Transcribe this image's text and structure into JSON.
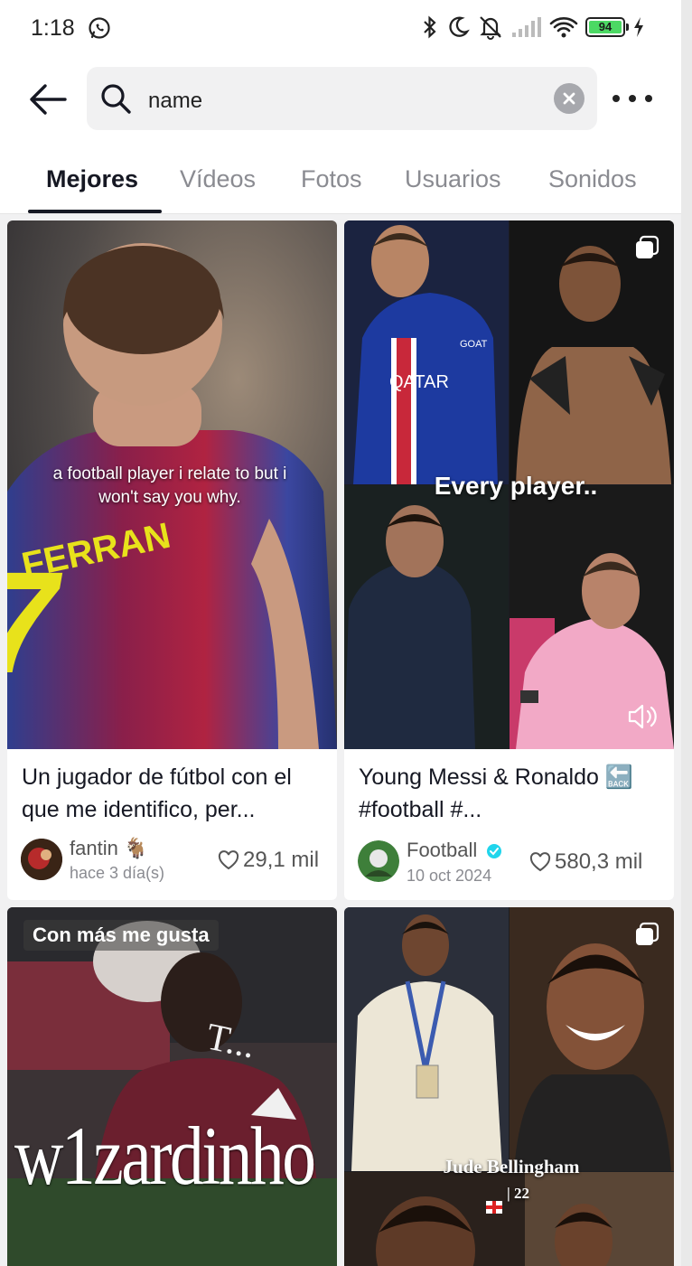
{
  "status_bar": {
    "time": "1:18",
    "battery": "94"
  },
  "search": {
    "query": "name"
  },
  "tabs": [
    {
      "label": "Mejores",
      "active": true
    },
    {
      "label": "Vídeos",
      "active": false
    },
    {
      "label": "Fotos",
      "active": false
    },
    {
      "label": "Usuarios",
      "active": false
    },
    {
      "label": "Sonidos",
      "active": false
    }
  ],
  "results": [
    {
      "overlay": "a football player i relate to but i won't say you why.",
      "jersey_name": "FERRAN",
      "jersey_number": "7",
      "caption": "Un jugador de fútbol con el que me identifico, per...",
      "author": "fantin 🐐",
      "date": "hace 3 día(s)",
      "likes": "29,1 mil"
    },
    {
      "overlay": "Every player..",
      "caption": "Young Messi & Ronaldo 🔙 #football #...",
      "author": "Football",
      "verified": true,
      "date": "10 oct 2024",
      "likes": "580,3 mil"
    },
    {
      "badge": "Con más me gusta",
      "overlay": "w1zardinho"
    },
    {
      "overlay_name": "Jude Bellingham",
      "overlay_sub": "🏴󠁧󠁢󠁥󠁮󠁧󠁿 | 22"
    }
  ],
  "colors": {
    "accent": "#161823",
    "verified": "#20d5ec",
    "battery": "#4cd964"
  }
}
